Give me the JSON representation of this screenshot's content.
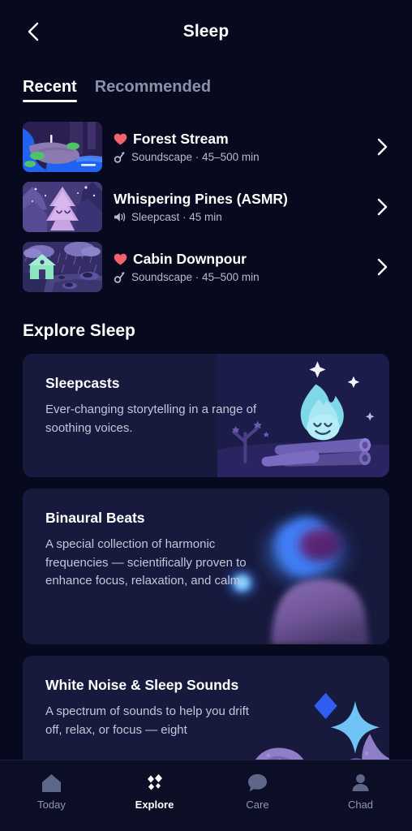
{
  "header": {
    "title": "Sleep",
    "back_icon": "chevron-left-icon"
  },
  "tabs": [
    {
      "label": "Recent",
      "active": true
    },
    {
      "label": "Recommended",
      "active": false
    }
  ],
  "recent": {
    "items": [
      {
        "title": "Forest Stream",
        "favorited": true,
        "favorite_icon": "heart-icon",
        "type_icon": "soundscape-icon",
        "meta": "Soundscape · 45–500 min",
        "chevron_icon": "chevron-right-icon",
        "thumb": "forest-stream-thumbnail"
      },
      {
        "title": "Whispering Pines (ASMR)",
        "favorited": false,
        "favorite_icon": "",
        "type_icon": "speaker-icon",
        "meta": "Sleepcast · 45 min",
        "chevron_icon": "chevron-right-icon",
        "thumb": "whispering-pines-thumbnail"
      },
      {
        "title": "Cabin Downpour",
        "favorited": true,
        "favorite_icon": "heart-icon",
        "type_icon": "soundscape-icon",
        "meta": "Soundscape · 45–500 min",
        "chevron_icon": "chevron-right-icon",
        "thumb": "cabin-downpour-thumbnail"
      }
    ]
  },
  "explore": {
    "section_title": "Explore Sleep",
    "cards": [
      {
        "title": "Sleepcasts",
        "description": "Ever-changing storytelling in a range of soothing voices.",
        "art": "campfire-illustration"
      },
      {
        "title": "Binaural Beats",
        "description": "A special collection of harmonic frequencies — scientifically proven to enhance focus, relaxation, and calm.",
        "art": "abstract-glow-illustration"
      },
      {
        "title": "White Noise & Sleep Sounds",
        "description": "A spectrum of sounds to help you drift off, relax, or focus — eight",
        "art": "diamond-waves-illustration"
      }
    ]
  },
  "bottom_nav": {
    "items": [
      {
        "label": "Today",
        "icon": "home-icon",
        "active": false
      },
      {
        "label": "Explore",
        "icon": "sparkle-diamonds-icon",
        "active": true
      },
      {
        "label": "Care",
        "icon": "speech-bubble-icon",
        "active": false
      },
      {
        "label": "Chad",
        "icon": "person-icon",
        "active": false
      }
    ]
  },
  "colors": {
    "background": "#070a1e",
    "card": "#171a3d",
    "accent_heart": "#f1636a",
    "text_primary": "#ffffff",
    "text_secondary": "#b8bbcf",
    "text_muted": "#8d90ab",
    "nav_bar": "#0b0e24"
  }
}
